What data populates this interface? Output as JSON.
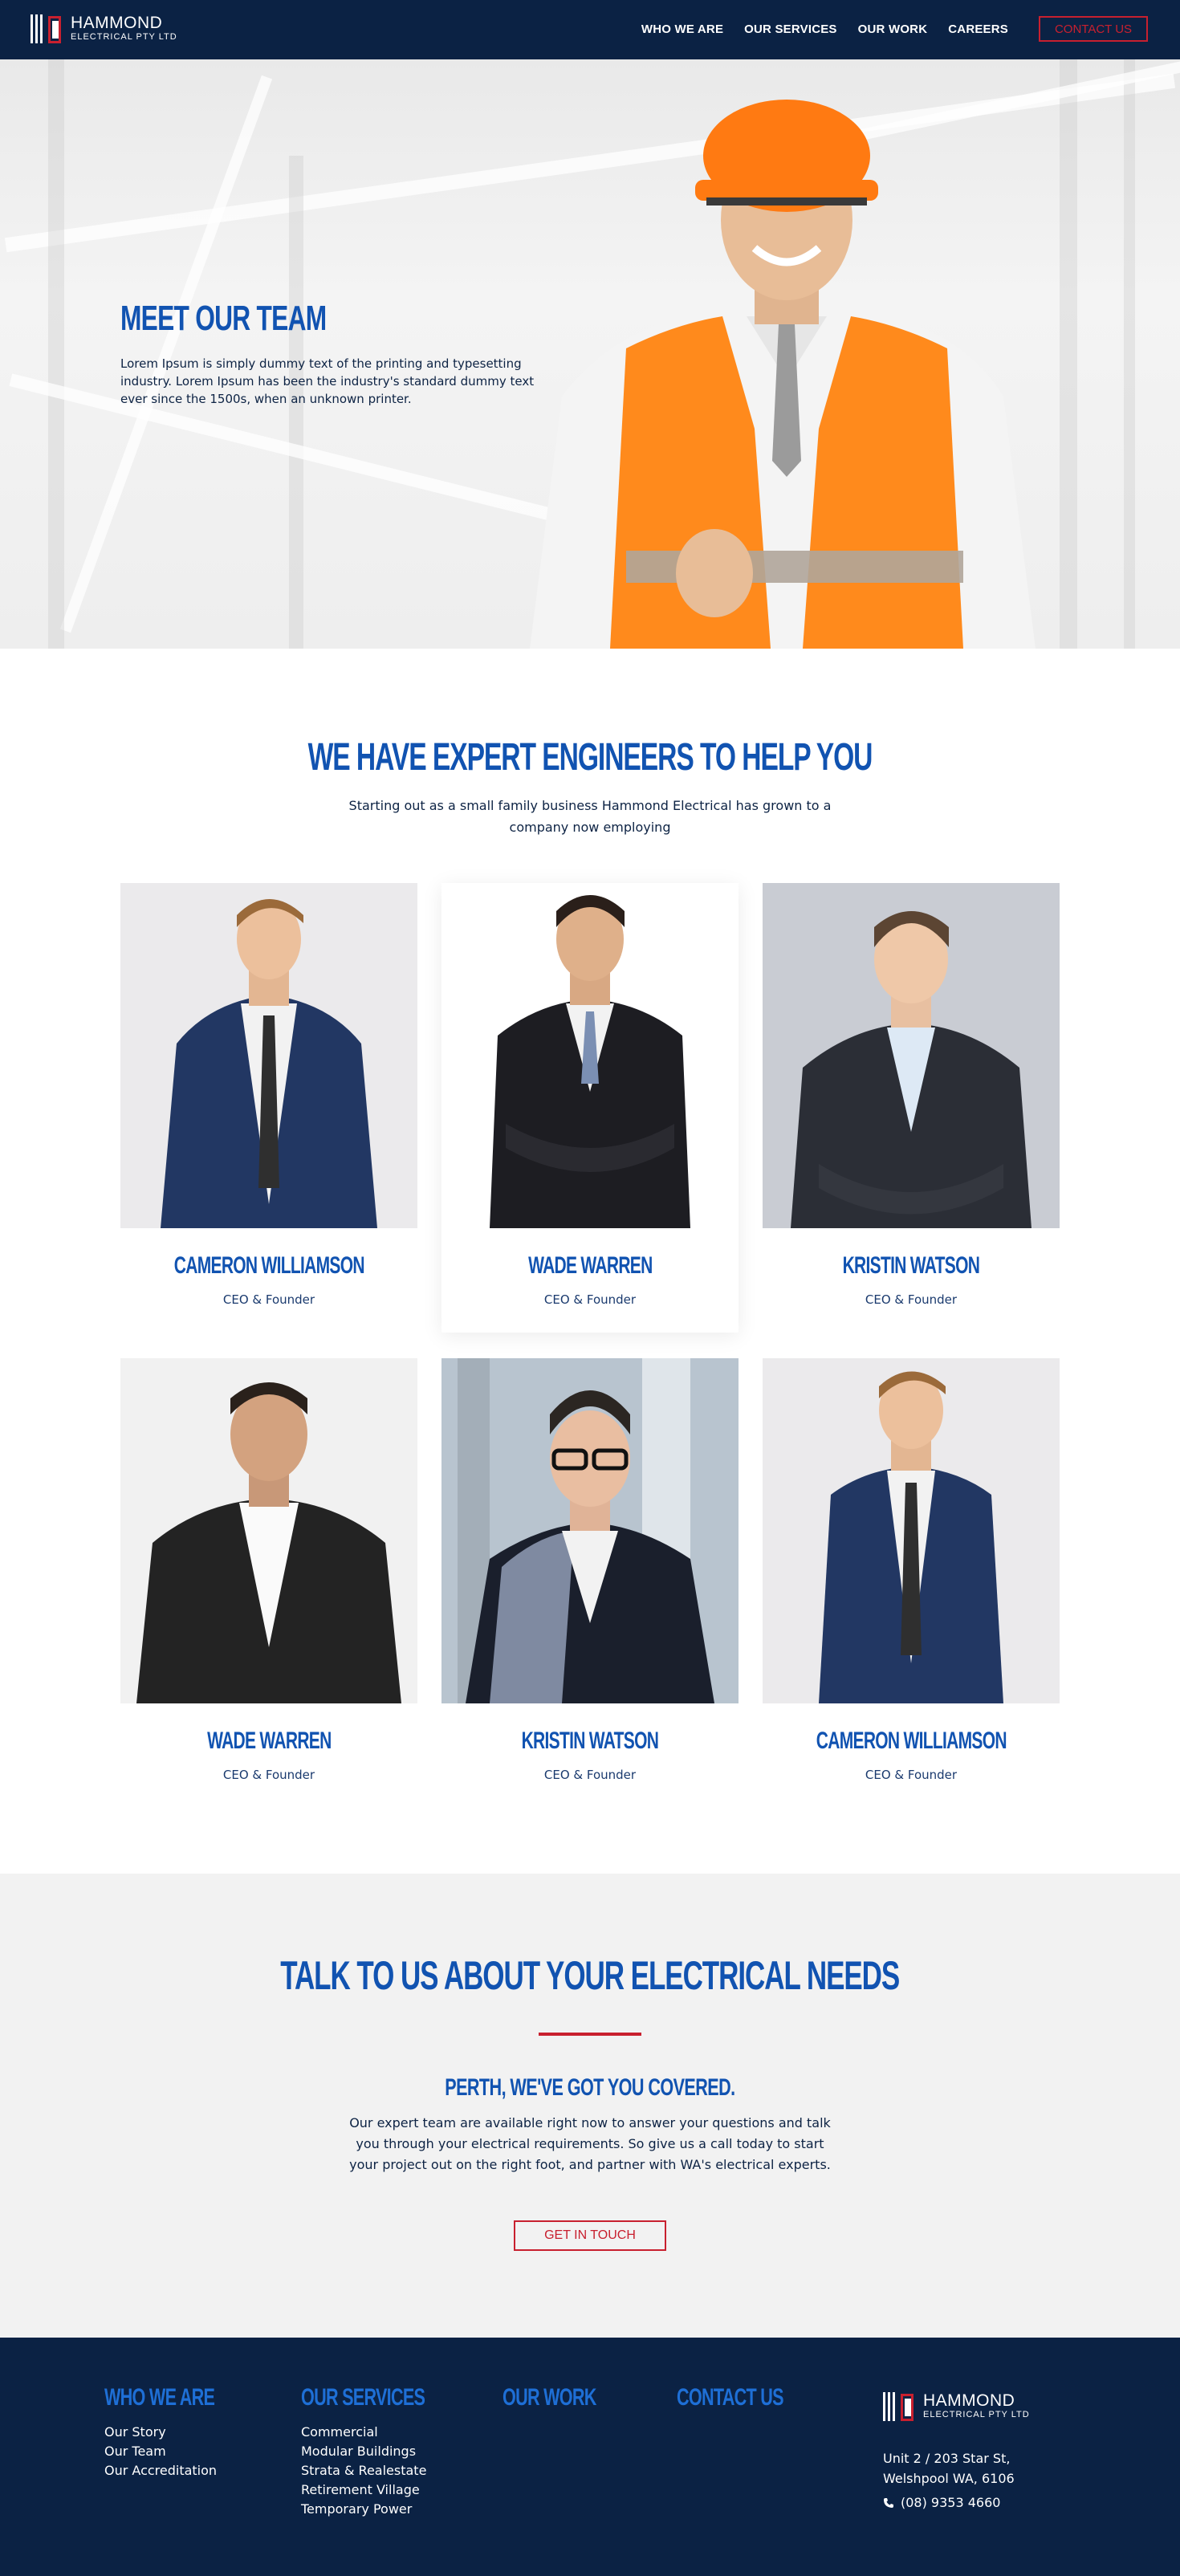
{
  "nav": {
    "logo_line1": "HAMMOND",
    "logo_line2": "ELECTRICAL PTY LTD",
    "links": [
      "WHO WE ARE",
      "OUR SERVICES",
      "OUR WORK",
      "CAREERS"
    ],
    "cta": "CONTACT US"
  },
  "hero": {
    "title": "MEET OUR TEAM",
    "text": "Lorem Ipsum is simply dummy text of the printing and typesetting industry. Lorem Ipsum has been the industry's standard dummy text ever since the 1500s, when an unknown printer."
  },
  "team": {
    "heading": "WE HAVE EXPERT ENGINEERS TO HELP YOU",
    "subheading": "Starting out as a small family business Hammond Electrical has grown to a company now employing",
    "members": [
      {
        "name": "CAMERON WILLIAMSON",
        "role": "CEO & Founder"
      },
      {
        "name": "WADE WARREN",
        "role": "CEO & Founder"
      },
      {
        "name": "KRISTIN WATSON",
        "role": "CEO & Founder"
      },
      {
        "name": "WADE WARREN",
        "role": "CEO & Founder"
      },
      {
        "name": "KRISTIN WATSON",
        "role": "CEO & Founder"
      },
      {
        "name": "CAMERON WILLIAMSON",
        "role": "CEO & Founder"
      }
    ]
  },
  "contact": {
    "heading": "TALK TO US ABOUT YOUR ELECTRICAL NEEDS",
    "subheading": "PERTH, WE'VE GOT YOU COVERED.",
    "text": "Our expert team are available right now to answer your questions and talk you through your electrical requirements. So give us a call today to start your project out on the right foot, and partner with WA's electrical experts.",
    "button": "GET IN TOUCH"
  },
  "footer": {
    "who_heading": "WHO WE ARE",
    "who_links": [
      "Our Story",
      "Our Team",
      "Our Accreditation"
    ],
    "services_heading": "OUR SERVICES",
    "services_links": [
      "Commercial",
      "Modular Buildings",
      "Strata & Realestate",
      "Retirement Village",
      "Temporary Power"
    ],
    "work_heading": "OUR WORK",
    "contact_heading": "CONTACT US",
    "logo_line1": "HAMMOND",
    "logo_line2": "ELECTRICAL PTY LTD",
    "address_line1": "Unit 2 / 203 Star St,",
    "address_line2": "Welshpool WA, 6106",
    "phone": "(08) 9353 4660"
  },
  "colors": {
    "navy": "#0b2244",
    "brand_blue": "#1153b1",
    "accent_red": "#c8202f",
    "light_band": "#f2f2f2"
  }
}
